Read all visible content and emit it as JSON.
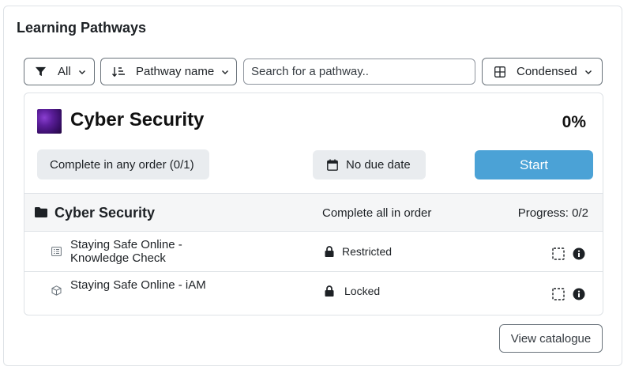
{
  "card": {
    "title": "Learning Pathways"
  },
  "toolbar": {
    "filter_label": "All",
    "sort_label": "Pathway name",
    "search": {
      "placeholder": "Search for a pathway..",
      "value": ""
    },
    "view_label": "Condensed"
  },
  "pathway": {
    "title": "Cyber Security",
    "progress": "0%",
    "order_pill": "Complete in any order (0/1)",
    "due_pill": "No due date",
    "start_label": "Start",
    "start_color": "#4ba2d6",
    "section": {
      "title": "Cyber Security",
      "order": "Complete all in order",
      "progress": "Progress: 0/2",
      "items": [
        {
          "name_line1": "Staying Safe Online -",
          "name_line2": "Knowledge Check",
          "status": "Restricted",
          "icon": "quiz-icon"
        },
        {
          "name_line1": "Staying Safe Online - iAM",
          "name_line2": "",
          "status": "Locked",
          "icon": "package-icon"
        }
      ]
    }
  },
  "footer": {
    "view_catalogue": "View catalogue"
  }
}
